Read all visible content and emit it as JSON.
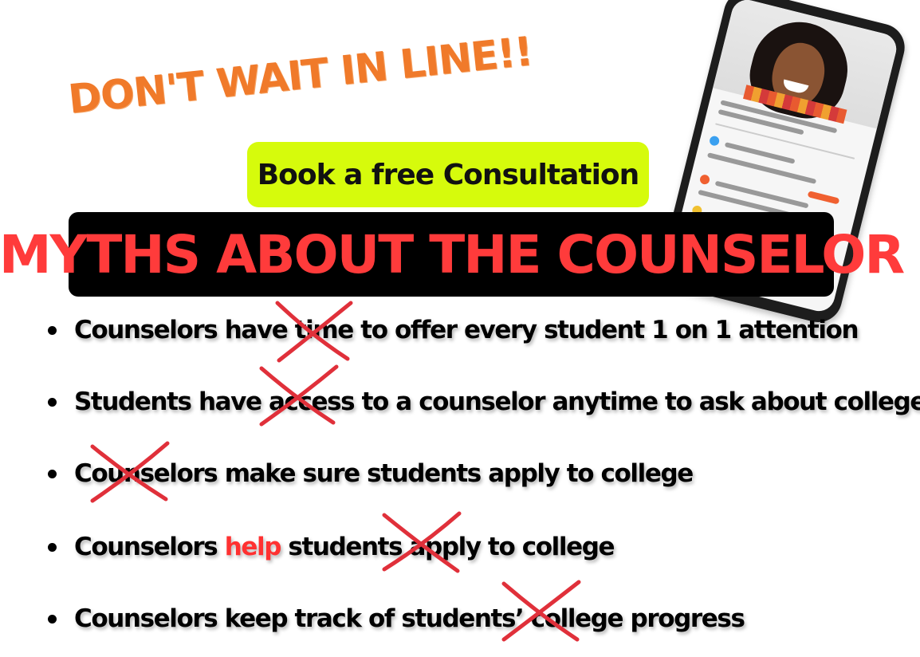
{
  "tagline": "DON'T WAIT IN LINE!!",
  "cta_button": "Book a free Consultation",
  "banner_title": "MYTHS ABOUT THE COUNSELOR",
  "myths": [
    "Counselors have time to offer every student 1 on 1 attention",
    "Students have access to a counselor anytime to ask about college",
    "Counselors make sure students apply to college",
    {
      "before": "Counselors ",
      "highlight": "help",
      "after": " students apply to college"
    },
    "Counselors keep track of students’ college progress"
  ],
  "icons": [
    "phone-mockup-icon",
    "bullet-icon",
    "cross-mark-icon"
  ],
  "colors": {
    "tagline": "#f07a2a",
    "cta_bg": "#d6fb0c",
    "banner_bg": "#000000",
    "banner_text": "#ff3b3b",
    "highlight": "#ff3131",
    "cross": "#e0303a"
  }
}
